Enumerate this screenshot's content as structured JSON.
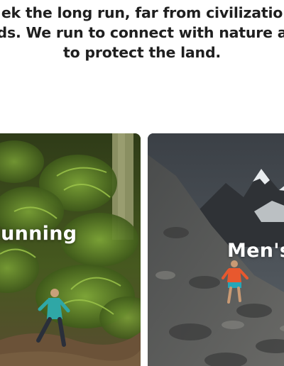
{
  "intro": {
    "lines": [
      "ek the long run, far from civilizatio",
      "ds. We run to connect with nature a",
      "to protect the land."
    ]
  },
  "cards": [
    {
      "title": "Running"
    },
    {
      "title": "Men's"
    }
  ],
  "colors": {
    "text": "#1f1f1f",
    "card_title": "#ffffff",
    "forest_green": "#3c4a22",
    "mountain_gray": "#505559"
  }
}
